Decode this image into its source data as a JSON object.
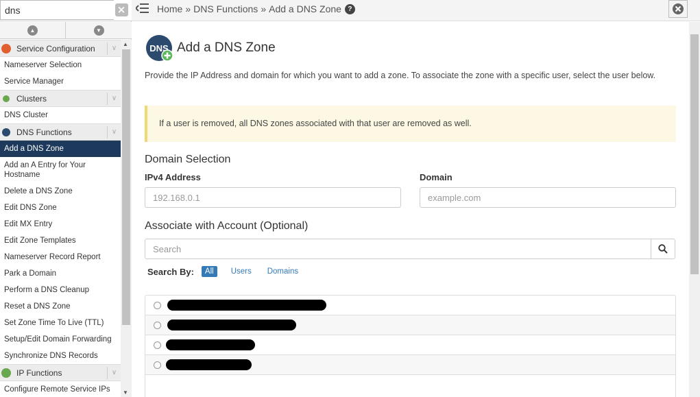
{
  "sidebar": {
    "search_value": "dns",
    "clear_icon": "x-icon",
    "categories": [
      {
        "label": "Service Configuration",
        "icon": "wrench-icon",
        "icon_color": "#e06030"
      },
      {
        "label": "Clusters",
        "icon": "cluster-icon",
        "icon_color": "#6aa84f"
      },
      {
        "label": "DNS Functions",
        "icon": "dns-icon",
        "icon_color": "#2c4a6e"
      },
      {
        "label": "IP Functions",
        "icon": "ip-icon",
        "icon_color": "#6aa84f"
      }
    ],
    "items": {
      "service": [
        "Nameserver Selection",
        "Service Manager"
      ],
      "clusters": [
        "DNS Cluster"
      ],
      "dns": [
        "Add a DNS Zone",
        "Add an A Entry for Your Hostname",
        "Delete a DNS Zone",
        "Edit DNS Zone",
        "Edit MX Entry",
        "Edit Zone Templates",
        "Nameserver Record Report",
        "Park a Domain",
        "Perform a DNS Cleanup",
        "Reset a DNS Zone",
        "Set Zone Time To Live (TTL)",
        "Setup/Edit Domain Forwarding",
        "Synchronize DNS Records"
      ],
      "ip": [
        "Configure Remote Service IPs"
      ]
    }
  },
  "header": {
    "breadcrumb": [
      "Home",
      "DNS Functions",
      "Add a DNS Zone"
    ],
    "separator": "»",
    "help_icon": "?"
  },
  "main": {
    "logo_text": "DNS",
    "title": "Add a DNS Zone",
    "intro": "Provide the IP Address and domain for which you want to add a zone. To associate the zone with a specific user, select the user below.",
    "callout": "If a user is removed, all DNS zones associated with that user are removed as well.",
    "domain_section": "Domain Selection",
    "ipv4_label": "IPv4 Address",
    "ipv4_placeholder": "192.168.0.1",
    "domain_label": "Domain",
    "domain_placeholder": "example.com",
    "account_section": "Associate with Account (Optional)",
    "search_placeholder": "Search",
    "search_by_label": "Search By:",
    "filters": [
      "All",
      "Users",
      "Domains"
    ],
    "accent_color": "#337ab7"
  }
}
